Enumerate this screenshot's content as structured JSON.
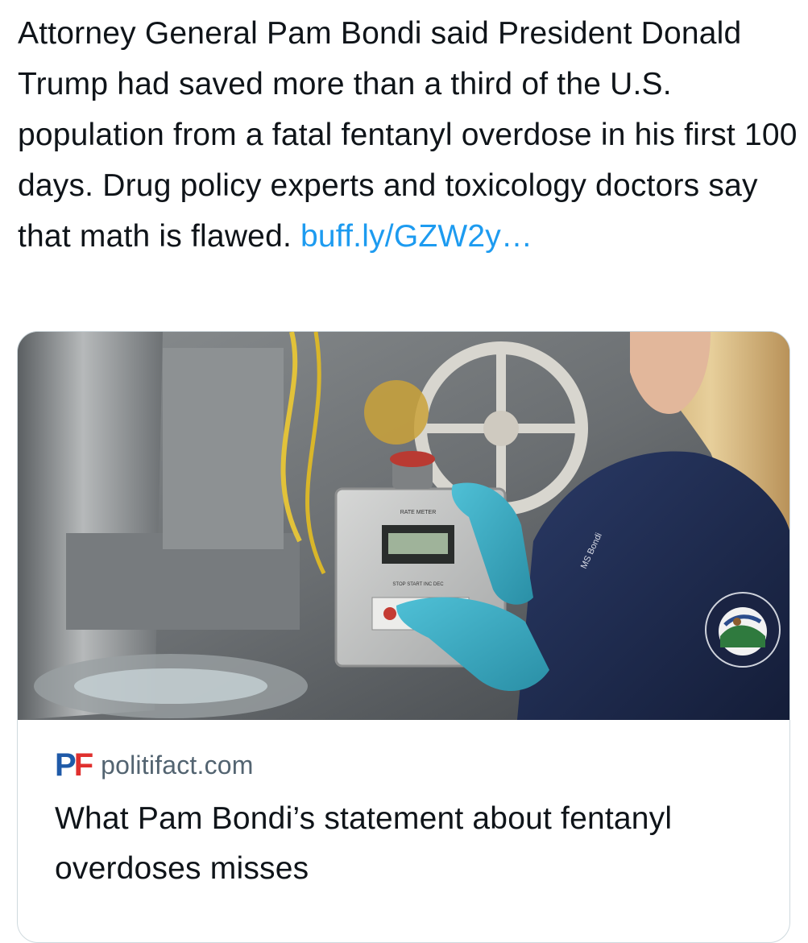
{
  "post": {
    "text_main": "Attorney General Pam Bondi said President Donald Trump had saved more than a third of the U.S. population from a fatal fentanyl overdose in his first 100 days. Drug policy experts and toxicology doctors say that math is flawed. ",
    "link_text": "buff.ly/GZW2y…"
  },
  "card": {
    "image_alt": "Woman in DEA jacket wearing blue gloves operating a pill press machine",
    "jacket_emblem_text": "U.S. Department of Justice · Drug Enforcement Administration",
    "machine_label_top": "RATE METER",
    "machine_buttons_label": "STOP  START  INC  DEC",
    "logo_p": "P",
    "logo_f": "F",
    "domain": "politifact.com",
    "title": "What Pam Bondi’s statement about fentanyl overdoses misses"
  },
  "colors": {
    "link": "#1d9bf0",
    "text": "#0f1419",
    "secondary_text": "#536471",
    "card_border": "#cfd9de",
    "logo_blue": "#1f5aa8",
    "logo_red": "#e0302e"
  }
}
